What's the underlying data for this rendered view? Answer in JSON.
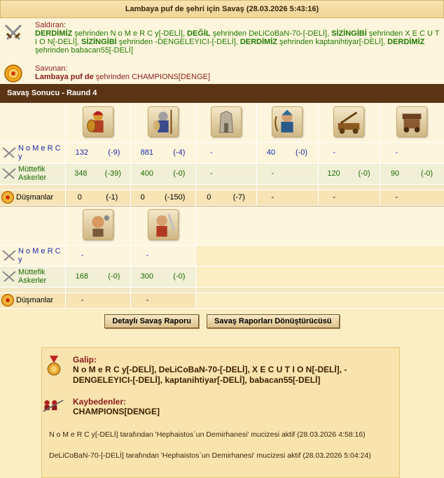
{
  "header": {
    "title": "Lambaya puf de şehri için Savaş (28.03.2026 5:43:16)"
  },
  "attacker": {
    "label": "Saldıran:",
    "text": [
      {
        "b": "DERDİMİZ",
        "t": " şehrinden N o M e R C y[-DELİ], "
      },
      {
        "b": "DEĞİL",
        "t": " şehrinden DeLiCoBaN-70-[-DELİ], "
      },
      {
        "b": "SİZİNGİBİ",
        "t": " şehrinden X E C U T I O N[-DELİ], "
      },
      {
        "b": "SİZİNGİBİ",
        "t": " şehrinden -DENGELEYICI-[-DELİ], "
      },
      {
        "b": "DERDİMİZ",
        "t": " şehrinden kaptanihtiyar[-DELİ], "
      },
      {
        "b": "DERDİMİZ",
        "t": " şehrinden babacan55[-DELİ]"
      }
    ]
  },
  "defender": {
    "label": "Savunan:",
    "city": "Lambaya puf de",
    "text": " şehrinden CHAMPIONS[DENGE]"
  },
  "round": {
    "title": "Savaş Sonucu - Raund 4"
  },
  "rows_labels": {
    "nomercy": "N o M e R C y",
    "muttefik": "Müttefik Askerler",
    "dusman": "Düşmanlar"
  },
  "table1": {
    "units": [
      "Hoplit",
      "Mızraklı",
      "Duvar",
      "Okçu",
      "Mancınık",
      "Koçbaşı"
    ],
    "nomercy": [
      [
        "132",
        "(-9)"
      ],
      [
        "881",
        "(-4)"
      ],
      [
        "-",
        ""
      ],
      [
        "40",
        "(-0)"
      ],
      [
        "-",
        ""
      ],
      [
        "-",
        ""
      ]
    ],
    "muttefik": [
      [
        "348",
        "(-39)"
      ],
      [
        "400",
        "(-0)"
      ],
      [
        "-",
        ""
      ],
      [
        "-",
        ""
      ],
      [
        "120",
        "(-0)"
      ],
      [
        "90",
        "(-0)"
      ]
    ],
    "dusman": [
      [
        "0",
        "(-1)"
      ],
      [
        "0",
        "(-150)"
      ],
      [
        "0",
        "(-7)"
      ],
      [
        "-",
        ""
      ],
      [
        "-",
        ""
      ],
      [
        "-",
        ""
      ]
    ]
  },
  "table2": {
    "units": [
      "Sapan",
      "Kılıçlı"
    ],
    "nomercy": [
      [
        "-",
        ""
      ],
      [
        "-",
        ""
      ]
    ],
    "muttefik": [
      [
        "168",
        "(-0)"
      ],
      [
        "300",
        "(-0)"
      ]
    ],
    "dusman": [
      [
        "-",
        ""
      ],
      [
        "-",
        ""
      ]
    ]
  },
  "buttons": {
    "detail": "Detaylı Savaş Raporu",
    "converter": "Savaş Raporları Dönüştürücüsü"
  },
  "result": {
    "winner_label": "Galip:",
    "winners": "N o M e R C y[-DELİ], DeLiCoBaN-70-[-DELİ], X E C U T I O N[-DELİ], -DENGELEYICI-[-DELİ], kaptanihtiyar[-DELİ], babacan55[-DELİ]",
    "loser_label": "Kaybedenler:",
    "losers": "CHAMPIONS[DENGE]",
    "miracle1": "N o M e R C y[-DELİ] tarafından 'Hephaistos`un Demirhanesi' mucizesi aktif (28.03.2026 4:58:16)",
    "miracle2": "DeLiCoBaN-70-[-DELİ] tarafından 'Hephaistos`un Demirhanesi' mucizesi aktif (28.03.2026 5:04:24)"
  },
  "colors": {
    "round_bar": "#5a3414",
    "attacker_green": "#1e7a00",
    "player_blue": "#1c2aa8",
    "defender_red": "#8b1a1a"
  },
  "icons": {
    "attack": "crossed-swords-icon",
    "defend": "shield-medallion-icon",
    "enemy": "enemy-medallion-icon",
    "winner": "medal-icon",
    "loser": "fallen-soldiers-icon"
  }
}
